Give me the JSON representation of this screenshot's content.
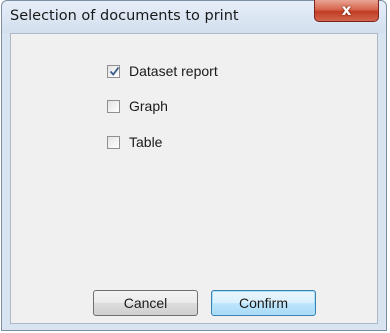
{
  "window": {
    "title": "Selection of documents to print",
    "close_label": "x"
  },
  "options": [
    {
      "label": "Dataset report",
      "checked": true
    },
    {
      "label": "Graph",
      "checked": false
    },
    {
      "label": "Table",
      "checked": false
    }
  ],
  "buttons": {
    "cancel_label": "Cancel",
    "confirm_label": "Confirm"
  }
}
